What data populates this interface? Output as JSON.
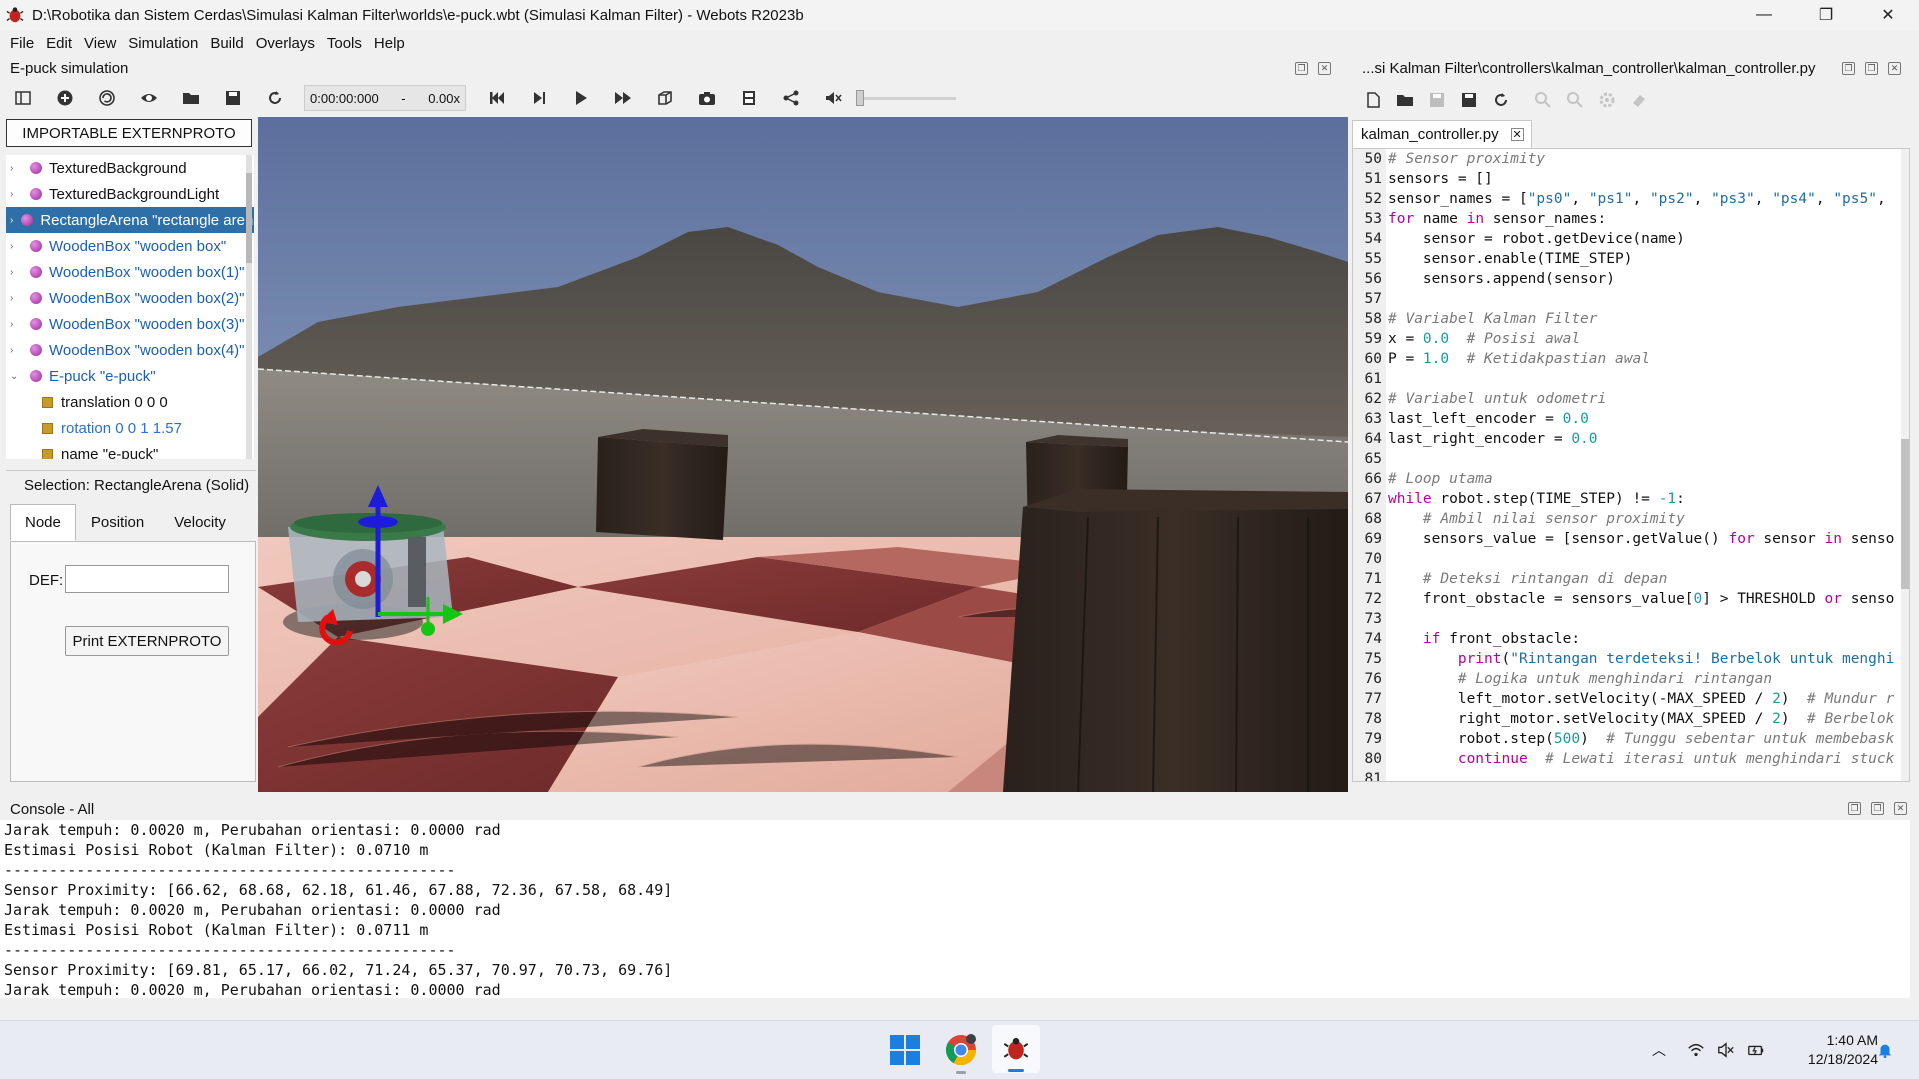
{
  "window": {
    "title": "D:\\Robotika dan Sistem Cerdas\\Simulasi Kalman Filter\\worlds\\e-puck.wbt (Simulasi Kalman Filter) - Webots R2023b",
    "minimize": "—",
    "maximize": "❐",
    "close": "✕"
  },
  "menu": [
    "File",
    "Edit",
    "View",
    "Simulation",
    "Build",
    "Overlays",
    "Tools",
    "Help"
  ],
  "scene_panel": {
    "title": "E-puck simulation",
    "toolbar": {
      "time": "0:00:00:000",
      "speed_sep": "-",
      "speed": "0.00x"
    },
    "import_button": "IMPORTABLE EXTERNPROTO",
    "tree": [
      {
        "label": "TexturedBackground",
        "kind": "node",
        "style": "normal"
      },
      {
        "label": "TexturedBackgroundLight",
        "kind": "node",
        "style": "normal"
      },
      {
        "label": "RectangleArena \"rectangle arena\"",
        "kind": "node",
        "style": "selected"
      },
      {
        "label": "WoodenBox \"wooden box\"",
        "kind": "node",
        "style": "blue"
      },
      {
        "label": "WoodenBox \"wooden box(1)\"",
        "kind": "node",
        "style": "blue"
      },
      {
        "label": "WoodenBox \"wooden box(2)\"",
        "kind": "node",
        "style": "blue"
      },
      {
        "label": "WoodenBox \"wooden box(3)\"",
        "kind": "node",
        "style": "blue"
      },
      {
        "label": "WoodenBox \"wooden box(4)\"",
        "kind": "node",
        "style": "blue"
      },
      {
        "label": "E-puck \"e-puck\"",
        "kind": "node-open",
        "style": "blue"
      },
      {
        "label": "translation 0 0 0",
        "kind": "field",
        "style": "normal"
      },
      {
        "label": "rotation 0 0 1 1.57",
        "kind": "field",
        "style": "blue2"
      },
      {
        "label": "name \"e-puck\"",
        "kind": "field",
        "style": "normal"
      }
    ],
    "selection_label": "Selection: RectangleArena (Solid)",
    "tabs": [
      "Node",
      "Position",
      "Velocity"
    ],
    "def_label": "DEF:",
    "def_value": "",
    "print_button": "Print EXTERNPROTO"
  },
  "editor": {
    "path_title": "...si Kalman Filter\\controllers\\kalman_controller\\kalman_controller.py",
    "tab": "kalman_controller.py",
    "lines": [
      {
        "n": "50",
        "html": "<span class='cm'># Sensor proximity</span>"
      },
      {
        "n": "51",
        "html": "sensors = []"
      },
      {
        "n": "52",
        "html": "sensor_names = [<span class='st'>\"ps0\"</span>, <span class='st'>\"ps1\"</span>, <span class='st'>\"ps2\"</span>, <span class='st'>\"ps3\"</span>, <span class='st'>\"ps4\"</span>, <span class='st'>\"ps5\"</span>,"
      },
      {
        "n": "53",
        "html": "<span class='kw'>for</span> name <span class='kw'>in</span> sensor_names:"
      },
      {
        "n": "54",
        "html": "    sensor = robot.getDevice(name)"
      },
      {
        "n": "55",
        "html": "    sensor.enable(TIME_STEP)"
      },
      {
        "n": "56",
        "html": "    sensors.append(sensor)"
      },
      {
        "n": "57",
        "html": ""
      },
      {
        "n": "58",
        "html": "<span class='cm'># Variabel Kalman Filter</span>"
      },
      {
        "n": "59",
        "html": "x = <span class='nm'>0.0</span>  <span class='cm'># Posisi awal</span>"
      },
      {
        "n": "60",
        "html": "P = <span class='nm'>1.0</span>  <span class='cm'># Ketidakpastian awal</span>"
      },
      {
        "n": "61",
        "html": ""
      },
      {
        "n": "62",
        "html": "<span class='cm'># Variabel untuk odometri</span>"
      },
      {
        "n": "63",
        "html": "last_left_encoder = <span class='nm'>0.0</span>"
      },
      {
        "n": "64",
        "html": "last_right_encoder = <span class='nm'>0.0</span>"
      },
      {
        "n": "65",
        "html": ""
      },
      {
        "n": "66",
        "html": "<span class='cm'># Loop utama</span>"
      },
      {
        "n": "67",
        "html": "<span class='kw'>while</span> robot.step(TIME_STEP) != <span class='nm'>-1</span>:"
      },
      {
        "n": "68",
        "html": "    <span class='cm'># Ambil nilai sensor proximity</span>"
      },
      {
        "n": "69",
        "html": "    sensors_value = [sensor.getValue() <span class='kw'>for</span> sensor <span class='kw'>in</span> senso"
      },
      {
        "n": "70",
        "html": ""
      },
      {
        "n": "71",
        "html": "    <span class='cm'># Deteksi rintangan di depan</span>"
      },
      {
        "n": "72",
        "html": "    front_obstacle = sensors_value[<span class='nm'>0</span>] &gt; THRESHOLD <span class='kw'>or</span> senso"
      },
      {
        "n": "73",
        "html": ""
      },
      {
        "n": "74",
        "html": "    <span class='kw'>if</span> front_obstacle:"
      },
      {
        "n": "75",
        "html": "        <span class='kw'>print</span>(<span class='st'>\"Rintangan terdeteksi! Berbelok untuk menghi</span>"
      },
      {
        "n": "76",
        "html": "        <span class='cm'># Logika untuk menghindari rintangan</span>"
      },
      {
        "n": "77",
        "html": "        left_motor.setVelocity(-MAX_SPEED / <span class='nm'>2</span>)  <span class='cm'># Mundur r</span>"
      },
      {
        "n": "78",
        "html": "        right_motor.setVelocity(MAX_SPEED / <span class='nm'>2</span>)  <span class='cm'># Berbelok</span>"
      },
      {
        "n": "79",
        "html": "        robot.step(<span class='nm'>500</span>)  <span class='cm'># Tunggu sebentar untuk membebask</span>"
      },
      {
        "n": "80",
        "html": "        <span class='kw'>continue</span>  <span class='cm'># Lewati iterasi untuk menghindari stuck</span>"
      },
      {
        "n": "81",
        "html": ""
      }
    ]
  },
  "console": {
    "title": "Console - All",
    "lines": [
      "Jarak tempuh: 0.0020 m, Perubahan orientasi: 0.0000 rad",
      "Estimasi Posisi Robot (Kalman Filter): 0.0710 m",
      "--------------------------------------------------",
      "Sensor Proximity: [66.62, 68.68, 62.18, 61.46, 67.88, 72.36, 67.58, 68.49]",
      "Jarak tempuh: 0.0020 m, Perubahan orientasi: 0.0000 rad",
      "Estimasi Posisi Robot (Kalman Filter): 0.0711 m",
      "--------------------------------------------------",
      "Sensor Proximity: [69.81, 65.17, 66.02, 71.24, 65.37, 70.97, 70.73, 69.76]",
      "Jarak tempuh: 0.0020 m, Perubahan orientasi: 0.0000 rad"
    ]
  },
  "taskbar": {
    "time": "1:40 AM",
    "date": "12/18/2024"
  },
  "colors": {
    "selected": "#2e6fa8",
    "keyword": "#b5009c",
    "string": "#1d6ea8",
    "comment": "#7a7a7a",
    "number": "#1a9a9a"
  }
}
